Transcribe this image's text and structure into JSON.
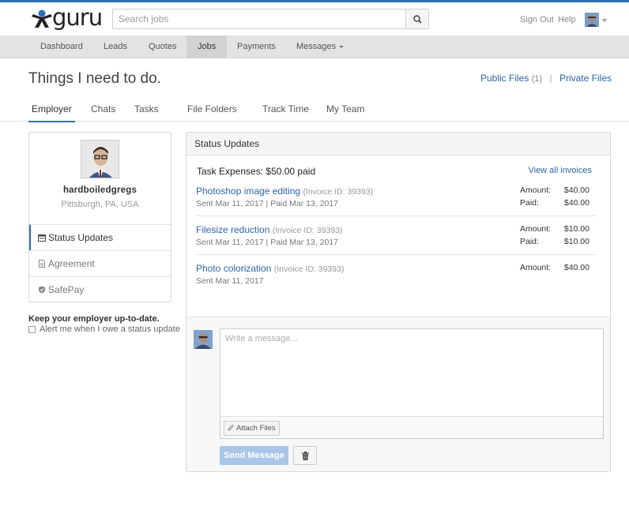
{
  "header": {
    "logo_text": "guru",
    "search_placeholder": "Search jobs",
    "sign_out": "Sign Out",
    "help": "Help"
  },
  "nav": {
    "items": [
      {
        "label": "Dashboard"
      },
      {
        "label": "Leads"
      },
      {
        "label": "Quotes"
      },
      {
        "label": "Jobs"
      },
      {
        "label": "Payments"
      },
      {
        "label": "Messages"
      }
    ],
    "active": "Jobs"
  },
  "page": {
    "title": "Things I need to do.",
    "public_files": "Public Files",
    "public_files_count": "(1)",
    "separator": "|",
    "private_files": "Private Files"
  },
  "tabs": [
    {
      "label": "Employer"
    },
    {
      "label": "Chats"
    },
    {
      "label": "Tasks"
    },
    {
      "label": "File Folders"
    },
    {
      "label": "Track Time"
    },
    {
      "label": "My Team"
    }
  ],
  "profile": {
    "name": "hardboiledgregs",
    "location": "Pittsburgh, PA, USA",
    "menu": [
      {
        "label": "Status Updates",
        "icon": "calendar-icon"
      },
      {
        "label": "Agreement",
        "icon": "document-icon"
      },
      {
        "label": "SafePay",
        "icon": "shield-icon"
      }
    ]
  },
  "reminder": {
    "heading": "Keep your employer up-to-date.",
    "checkbox_label": "Alert me when I owe a status update",
    "checked": false
  },
  "status": {
    "heading": "Status Updates",
    "task_expenses_label": "Task Expenses:",
    "task_expenses_value": "$50.00 paid",
    "view_all": "View all invoices",
    "invoices": [
      {
        "title": "Photoshop image editing",
        "id": "(Invoice ID: 39393)",
        "sent": "Sent Mar 11, 2017",
        "paid_date": "| Paid Mar 13, 2017",
        "amount_label": "Amount:",
        "amount": "$40.00",
        "paid_label": "Paid:",
        "paid": "$40.00"
      },
      {
        "title": "Filesize reduction",
        "id": "(Invoice ID: 39393)",
        "sent": "Sent Mar 11, 2017",
        "paid_date": "| Paid Mar 13, 2017",
        "amount_label": "Amount:",
        "amount": "$10.00",
        "paid_label": "Paid:",
        "paid": "$10.00"
      },
      {
        "title": "Photo colorization",
        "id": "(Invoice ID: 39393)",
        "sent": "Sent Mar 11, 2017",
        "amount_label": "Amount:",
        "amount": "$40.00"
      }
    ]
  },
  "compose": {
    "placeholder": "Write a message...",
    "attach": "Attach Files",
    "send": "Send Message"
  },
  "colors": {
    "accent": "#2f6db3",
    "link": "#2f64a8",
    "send_disabled": "#a9c6e8"
  }
}
